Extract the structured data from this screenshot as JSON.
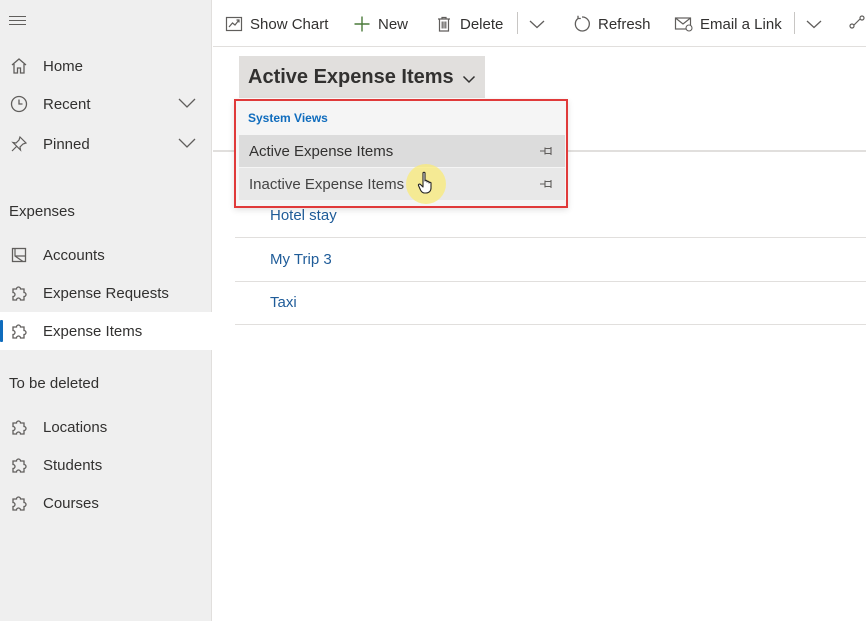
{
  "sidebar": {
    "nav": [
      {
        "label": "Home",
        "icon": "home-icon"
      },
      {
        "label": "Recent",
        "icon": "clock-icon",
        "expandable": true
      },
      {
        "label": "Pinned",
        "icon": "pin-icon",
        "expandable": true
      }
    ],
    "groups": [
      {
        "title": "Expenses",
        "items": [
          {
            "label": "Accounts",
            "icon": "account-icon"
          },
          {
            "label": "Expense Requests",
            "icon": "puzzle-icon"
          },
          {
            "label": "Expense Items",
            "icon": "puzzle-icon",
            "selected": true
          }
        ]
      },
      {
        "title": "To be deleted",
        "items": [
          {
            "label": "Locations",
            "icon": "puzzle-icon"
          },
          {
            "label": "Students",
            "icon": "puzzle-icon"
          },
          {
            "label": "Courses",
            "icon": "puzzle-icon"
          }
        ]
      }
    ]
  },
  "commandbar": {
    "show_chart": "Show Chart",
    "new": "New",
    "delete": "Delete",
    "refresh": "Refresh",
    "email_link": "Email a Link"
  },
  "view": {
    "current": "Active Expense Items"
  },
  "dropdown": {
    "header": "System Views",
    "items": [
      {
        "label": "Active Expense Items",
        "selected": true
      },
      {
        "label": "Inactive Expense Items",
        "hovered": true
      }
    ]
  },
  "grid": {
    "rows": [
      "Hotel stay",
      "My Trip 3",
      "Taxi"
    ]
  },
  "colors": {
    "accent": "#0f6cbd",
    "highlight_border": "#e03a3a",
    "link": "#1f5c99"
  }
}
